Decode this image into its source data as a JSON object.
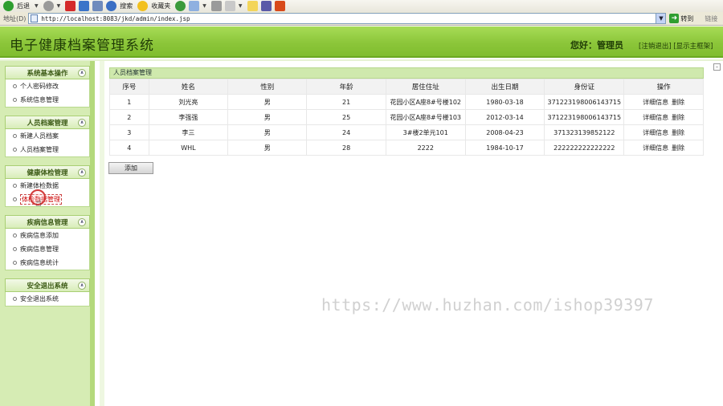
{
  "browser": {
    "toolbar": {
      "back_label": "后退",
      "search_label": "搜索",
      "favorites_label": "收藏夹"
    },
    "address": {
      "label": "地址(D)",
      "url": "http://localhost:8083/jkd/admin/index.jsp",
      "go_label": "转到",
      "links_label": "链接"
    }
  },
  "header": {
    "title": "电子健康档案管理系统",
    "greeting": "您好：管理员",
    "logout": "[注销退出]",
    "show_frame": "[显示主框架]"
  },
  "sidebar": {
    "groups": [
      {
        "title": "系统基本操作",
        "items": [
          {
            "label": "个人密码修改"
          },
          {
            "label": "系统信息管理"
          }
        ]
      },
      {
        "title": "人员档案管理",
        "items": [
          {
            "label": "新建人员档案"
          },
          {
            "label": "人员档案管理"
          }
        ]
      },
      {
        "title": "健康体检管理",
        "items": [
          {
            "label": "新建体检数据"
          },
          {
            "label": "体检数据管理"
          }
        ]
      },
      {
        "title": "疾病信息管理",
        "items": [
          {
            "label": "疾病信息添加"
          },
          {
            "label": "疾病信息管理"
          },
          {
            "label": "疾病信息统计"
          }
        ]
      },
      {
        "title": "安全退出系统",
        "items": [
          {
            "label": "安全退出系统"
          }
        ]
      }
    ]
  },
  "main": {
    "panel_title": "人员档案管理",
    "columns": [
      "序号",
      "姓名",
      "性别",
      "年龄",
      "居住住址",
      "出生日期",
      "身份证",
      "操作"
    ],
    "rows": [
      {
        "index": "1",
        "name": "刘光亮",
        "gender": "男",
        "age": "21",
        "address": "花园小区A座8#号楼102",
        "birth": "1980-03-18",
        "id_card": "371223198006143715"
      },
      {
        "index": "2",
        "name": "李强强",
        "gender": "男",
        "age": "25",
        "address": "花园小区A座8#号楼103",
        "birth": "2012-03-14",
        "id_card": "371223198006143715"
      },
      {
        "index": "3",
        "name": "李三",
        "gender": "男",
        "age": "24",
        "address": "3#楼2单元101",
        "birth": "2008-04-23",
        "id_card": "371323139852122"
      },
      {
        "index": "4",
        "name": "WHL",
        "gender": "男",
        "age": "28",
        "address": "2222",
        "birth": "1984-10-17",
        "id_card": "222222222222222"
      }
    ],
    "op_detail": "详细信息",
    "op_delete": "删除",
    "add_button": "添加"
  },
  "watermark": "https://www.huzhan.com/ishop39397",
  "colors": {
    "header_green": "#8cc63a",
    "sidebar_bg": "#d6ecb4",
    "panel_title_bg": "#cfe9ad",
    "active_item": "#cc0000"
  }
}
